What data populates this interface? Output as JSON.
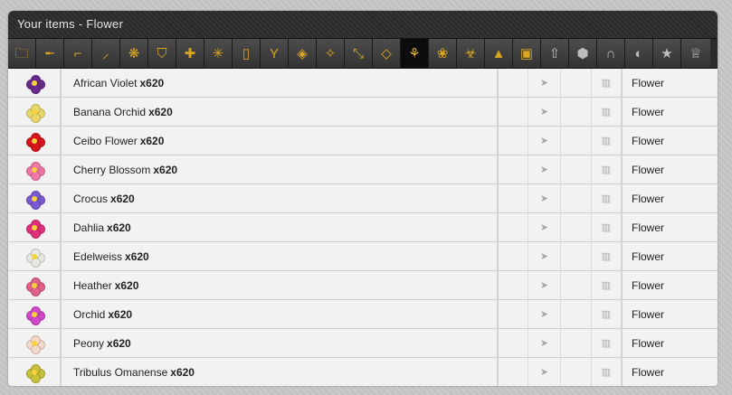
{
  "window": {
    "title": "Your items - Flower"
  },
  "tabs": [
    {
      "icon": "folder-icon",
      "glyph": "🗀"
    },
    {
      "icon": "rifle-icon",
      "glyph": "╾"
    },
    {
      "icon": "pistol-icon",
      "glyph": "⌐"
    },
    {
      "icon": "knife-icon",
      "glyph": "⸝"
    },
    {
      "icon": "grenade-icon",
      "glyph": "❋"
    },
    {
      "icon": "shield-icon",
      "glyph": "⛉"
    },
    {
      "icon": "medical-cross-icon",
      "glyph": "✚"
    },
    {
      "icon": "cannabis-leaf-icon",
      "glyph": "✳"
    },
    {
      "icon": "bottle-icon",
      "glyph": "▯"
    },
    {
      "icon": "cocktail-icon",
      "glyph": "Y"
    },
    {
      "icon": "candy-icon",
      "glyph": "◈"
    },
    {
      "icon": "magic-wand-icon",
      "glyph": "✧"
    },
    {
      "icon": "syringe-icon",
      "glyph": "⤡"
    },
    {
      "icon": "diamond-icon",
      "glyph": "◇"
    },
    {
      "icon": "flower-icon",
      "glyph": "⚘"
    },
    {
      "icon": "teddy-bear-icon",
      "glyph": "❀"
    },
    {
      "icon": "biohazard-icon",
      "glyph": "☣"
    },
    {
      "icon": "gold-bars-icon",
      "glyph": "▲"
    },
    {
      "icon": "shopping-bag-icon",
      "glyph": "▣"
    },
    {
      "icon": "upgrade-arrow-icon",
      "glyph": "⇧"
    },
    {
      "icon": "box-icon",
      "glyph": "⬢"
    },
    {
      "icon": "jacket-icon",
      "glyph": "∩"
    },
    {
      "icon": "car-icon",
      "glyph": "◐"
    },
    {
      "icon": "star-icon",
      "glyph": "★"
    },
    {
      "icon": "trophy-icon",
      "glyph": "♕"
    }
  ],
  "active_tab": "flower-icon",
  "send_icon_glyph": "➤",
  "trash_icon_glyph": "▥",
  "items": [
    {
      "name": "African Violet",
      "qty": "x620",
      "type": "Flower",
      "color": "#6a2a8c",
      "icon": "african-violet-icon"
    },
    {
      "name": "Banana Orchid",
      "qty": "x620",
      "type": "Flower",
      "color": "#e8d86a",
      "icon": "banana-orchid-icon"
    },
    {
      "name": "Ceibo Flower",
      "qty": "x620",
      "type": "Flower",
      "color": "#d8141c",
      "icon": "ceibo-flower-icon"
    },
    {
      "name": "Cherry Blossom",
      "qty": "x620",
      "type": "Flower",
      "color": "#ef78a8",
      "icon": "cherry-blossom-icon"
    },
    {
      "name": "Crocus",
      "qty": "x620",
      "type": "Flower",
      "color": "#7a5ad0",
      "icon": "crocus-icon"
    },
    {
      "name": "Dahlia",
      "qty": "x620",
      "type": "Flower",
      "color": "#e0307a",
      "icon": "dahlia-icon"
    },
    {
      "name": "Edelweiss",
      "qty": "x620",
      "type": "Flower",
      "color": "#e8e8e0",
      "icon": "edelweiss-icon"
    },
    {
      "name": "Heather",
      "qty": "x620",
      "type": "Flower",
      "color": "#e0608a",
      "icon": "heather-icon"
    },
    {
      "name": "Orchid",
      "qty": "x620",
      "type": "Flower",
      "color": "#d048c8",
      "icon": "orchid-icon"
    },
    {
      "name": "Peony",
      "qty": "x620",
      "type": "Flower",
      "color": "#f4d8c8",
      "icon": "peony-icon"
    },
    {
      "name": "Tribulus Omanense",
      "qty": "x620",
      "type": "Flower",
      "color": "#c8c03a",
      "icon": "tribulus-omanense-icon"
    }
  ]
}
